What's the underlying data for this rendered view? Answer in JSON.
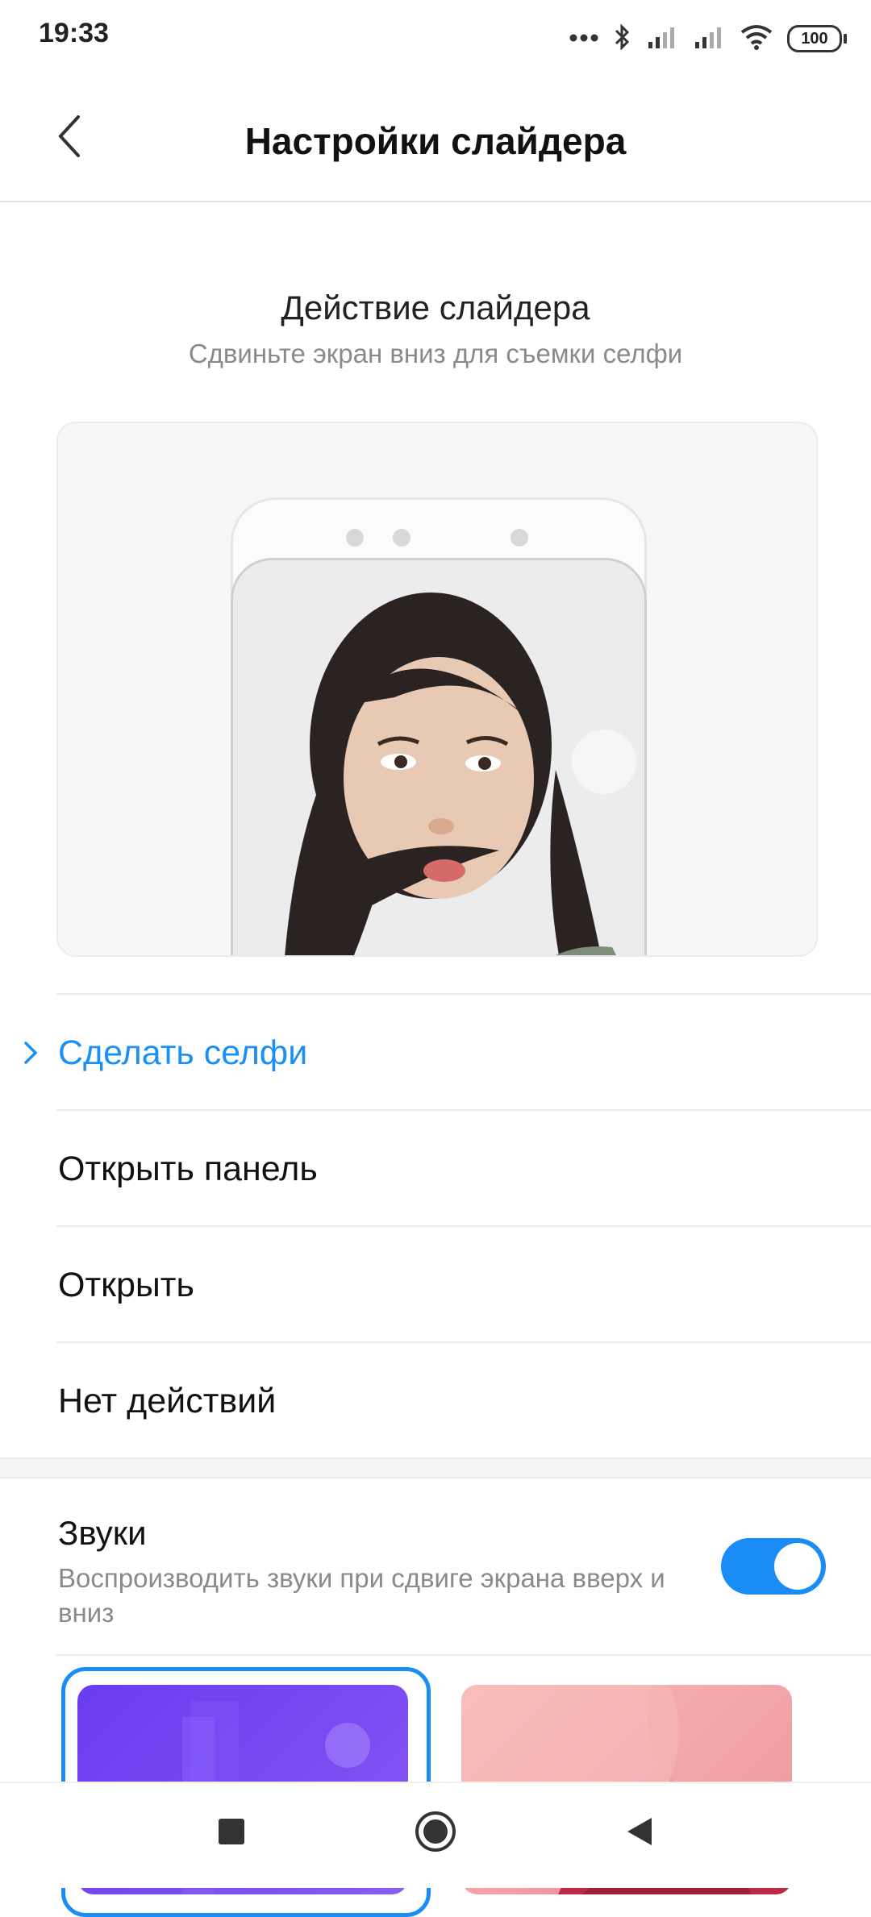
{
  "status_bar": {
    "time": "19:33",
    "battery": "100",
    "icons": [
      "more-dots-icon",
      "bluetooth-icon",
      "signal-icon",
      "signal-icon",
      "wifi-icon",
      "battery-icon"
    ]
  },
  "header": {
    "title": "Настройки слайдера",
    "back_icon": "chevron-left-icon"
  },
  "section": {
    "title": "Действие слайдера",
    "subtitle": "Сдвиньте экран вниз для съемки селфи"
  },
  "options": [
    {
      "label": "Сделать селфи",
      "selected": true
    },
    {
      "label": "Открыть панель",
      "selected": false
    },
    {
      "label": "Открыть",
      "selected": false
    },
    {
      "label": "Нет действий",
      "selected": false
    }
  ],
  "sounds": {
    "title": "Звуки",
    "description": "Воспроизводить звуки при сдвиге экрана вверх и вниз",
    "enabled": true
  },
  "themes": [
    {
      "name": "purple",
      "selected": true
    },
    {
      "name": "pink",
      "selected": false
    }
  ],
  "colors": {
    "accent": "#1a8cf5",
    "selected_text": "#1a90f5"
  },
  "nav": {
    "icons": [
      "recents-square-icon",
      "home-circle-icon",
      "back-triangle-icon"
    ]
  }
}
